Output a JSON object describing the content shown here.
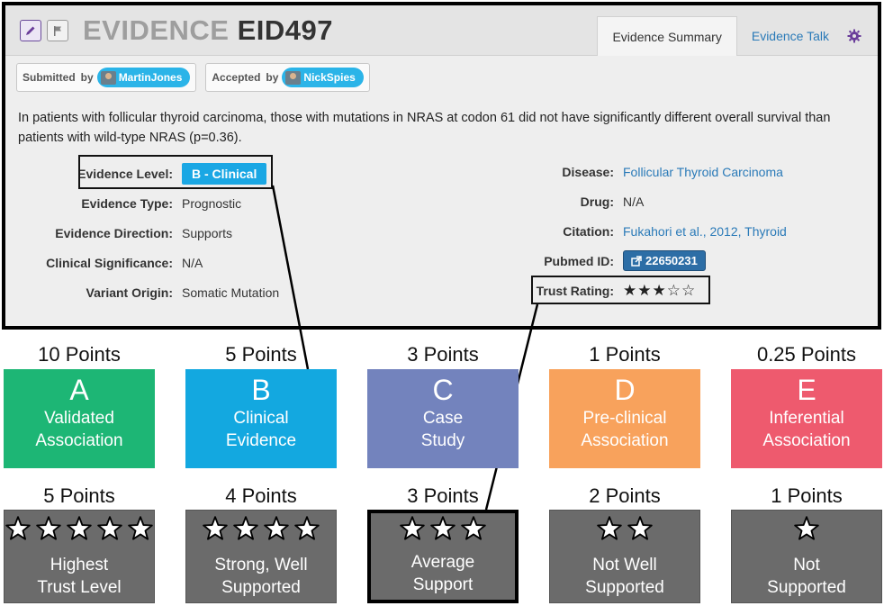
{
  "header": {
    "title_prefix": "EVIDENCE",
    "title_id": "EID497",
    "tabs": [
      {
        "label": "Evidence Summary"
      },
      {
        "label": "Evidence Talk"
      }
    ]
  },
  "submitted": {
    "label": "Submitted",
    "by": "by",
    "user": "MartinJones"
  },
  "accepted": {
    "label": "Accepted",
    "by": "by",
    "user": "NickSpies"
  },
  "statement": "In patients with follicular thyroid carcinoma, those with mutations in NRAS at codon 61 did not have significantly different overall survival than patients with wild-type NRAS (p=0.36).",
  "fields_left": [
    {
      "key": "Evidence Level:",
      "value": "B - Clinical"
    },
    {
      "key": "Evidence Type:",
      "value": "Prognostic"
    },
    {
      "key": "Evidence Direction:",
      "value": "Supports"
    },
    {
      "key": "Clinical Significance:",
      "value": "N/A"
    },
    {
      "key": "Variant Origin:",
      "value": "Somatic Mutation"
    }
  ],
  "fields_right": [
    {
      "key": "Disease:",
      "value": "Follicular Thyroid Carcinoma"
    },
    {
      "key": "Drug:",
      "value": "N/A"
    },
    {
      "key": "Citation:",
      "value": "Fukahori et al., 2012, Thyroid"
    },
    {
      "key": "Pubmed ID:",
      "value": "22650231"
    },
    {
      "key": "Trust Rating:",
      "value": "★★★☆☆"
    }
  ],
  "evidence_levels": [
    {
      "points": "10 Points",
      "letter": "A",
      "line1": "Validated",
      "line2": "Association",
      "color": "#1db675"
    },
    {
      "points": "5 Points",
      "letter": "B",
      "line1": "Clinical",
      "line2": "Evidence",
      "color": "#13a8e0"
    },
    {
      "points": "3 Points",
      "letter": "C",
      "line1": "Case",
      "line2": "Study",
      "color": "#7383bd"
    },
    {
      "points": "1 Points",
      "letter": "D",
      "line1": "Pre-clinical",
      "line2": "Association",
      "color": "#f8a25c"
    },
    {
      "points": "0.25 Points",
      "letter": "E",
      "line1": "Inferential",
      "line2": "Association",
      "color": "#ee5a6e"
    }
  ],
  "trust_levels": [
    {
      "points": "5 Points",
      "stars": 5,
      "line1": "Highest",
      "line2": "Trust Level"
    },
    {
      "points": "4 Points",
      "stars": 4,
      "line1": "Strong, Well",
      "line2": "Supported"
    },
    {
      "points": "3 Points",
      "stars": 3,
      "line1": "Average",
      "line2": "Support"
    },
    {
      "points": "2 Points",
      "stars": 2,
      "line1": "Not Well",
      "line2": "Supported"
    },
    {
      "points": "1 Points",
      "stars": 1,
      "line1": "Not",
      "line2": "Supported"
    }
  ],
  "icons": [
    "edit-icon",
    "flag-icon",
    "gear-icon",
    "external-link-icon",
    "star-icon"
  ],
  "colors": {
    "link": "#2a7ab8",
    "badge": "#1aa7e4",
    "pubmed": "#2d6ea6",
    "trust_box": "#6b6b6b",
    "purple": "#6a3d9a"
  }
}
